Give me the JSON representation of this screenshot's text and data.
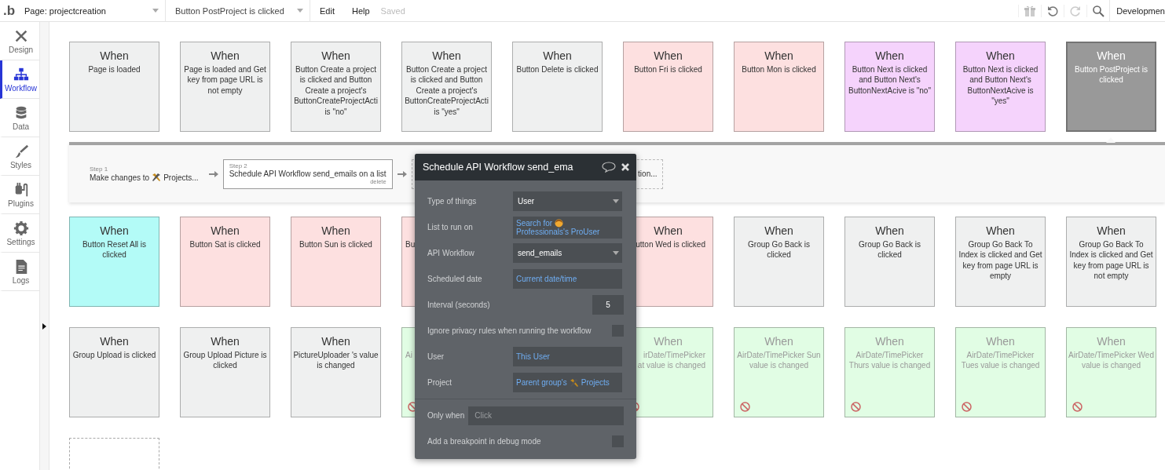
{
  "top_bar": {
    "logo": ".b",
    "page_select": "Page: projectcreation",
    "event_select": "Button PostProject is clicked",
    "menu": [
      "Edit",
      "Help"
    ],
    "save_status": "Saved",
    "environment": "Developmen"
  },
  "sidebar": {
    "items": [
      {
        "label": "Design",
        "selected": false
      },
      {
        "label": "Workflow",
        "selected": true
      },
      {
        "label": "Data",
        "selected": false
      },
      {
        "label": "Styles",
        "selected": false
      },
      {
        "label": "Plugins",
        "selected": false
      },
      {
        "label": "Settings",
        "selected": false
      },
      {
        "label": "Logs",
        "selected": false
      }
    ]
  },
  "event_rows": [
    [
      {
        "kind": "full",
        "heading": "When",
        "text": "Page is loaded",
        "color": "#eff0f0",
        "selected": false,
        "disabled": false
      },
      {
        "kind": "full",
        "heading": "When",
        "text": "Page is loaded and Get key from page URL is not empty",
        "color": "#eff0f0",
        "selected": false,
        "disabled": false
      },
      {
        "kind": "full",
        "heading": "When",
        "text": "Button Create a project is clicked and Button Create a project's ButtonCreateProjectActi is \"no\"",
        "color": "#eff0f0",
        "selected": false,
        "disabled": false
      },
      {
        "kind": "full",
        "heading": "When",
        "text": "Button Create a project is clicked and Button Create a project's ButtonCreateProjectActi is \"yes\"",
        "color": "#eff0f0",
        "selected": false,
        "disabled": false
      },
      {
        "kind": "full",
        "heading": "When",
        "text": "Button Delete is clicked",
        "color": "#eff0f0",
        "selected": false,
        "disabled": false
      },
      {
        "kind": "full",
        "heading": "When",
        "text": "Button Fri is clicked",
        "color": "#fde0e0",
        "selected": false,
        "disabled": false
      },
      {
        "kind": "full",
        "heading": "When",
        "text": "Button Mon is clicked",
        "color": "#fde0e0",
        "selected": false,
        "disabled": false
      },
      {
        "kind": "full",
        "heading": "When",
        "text": "Button Next is clicked and Button Next's ButtonNextAcive is \"no\"",
        "color": "#f5d3fc",
        "selected": false,
        "disabled": false
      },
      {
        "kind": "full",
        "heading": "When",
        "text": "Button Next is clicked and Button Next's ButtonNextAcive is \"yes\"",
        "color": "#f5d3fc",
        "selected": false,
        "disabled": false
      },
      {
        "kind": "full",
        "heading": "When",
        "text": "Button PostProject is clicked",
        "color": "#999999",
        "selected": true,
        "disabled": false
      }
    ],
    [
      {
        "kind": "full",
        "heading": "When",
        "text": "Button Reset All is clicked",
        "color": "#b3fbf7",
        "selected": false,
        "disabled": false
      },
      {
        "kind": "full",
        "heading": "When",
        "text": "Button Sat is clicked",
        "color": "#fde0e0",
        "selected": false,
        "disabled": false
      },
      {
        "kind": "full",
        "heading": "When",
        "text": "Button Sun is clicked",
        "color": "#fde0e0",
        "selected": false,
        "disabled": false
      },
      {
        "kind": "clip_left",
        "text": "Bu",
        "color": "#fde0e0",
        "selected": false,
        "disabled": false
      },
      {
        "kind": "hidden"
      },
      {
        "kind": "clip_right",
        "heading": "When",
        "text": "utton Wed is clicked",
        "color": "#fde0e0",
        "selected": false,
        "disabled": false
      },
      {
        "kind": "full",
        "heading": "When",
        "text": "Group Go Back is clicked",
        "color": "#eff0f0",
        "selected": false,
        "disabled": false
      },
      {
        "kind": "full",
        "heading": "When",
        "text": "Group Go Back is clicked",
        "color": "#eff0f0",
        "selected": false,
        "disabled": false
      },
      {
        "kind": "full",
        "heading": "When",
        "text": "Group Go Back To Index is clicked and Get key from page URL is empty",
        "color": "#eff0f0",
        "selected": false,
        "disabled": false
      },
      {
        "kind": "full",
        "heading": "When",
        "text": "Group Go Back To Index is clicked and Get key from page URL is not empty",
        "color": "#eff0f0",
        "selected": false,
        "disabled": false
      }
    ],
    [
      {
        "kind": "full",
        "heading": "When",
        "text": "Group Upload is clicked",
        "color": "#eff0f0",
        "selected": false,
        "disabled": false
      },
      {
        "kind": "full",
        "heading": "When",
        "text": "Group Upload Picture is clicked",
        "color": "#eff0f0",
        "selected": false,
        "disabled": false
      },
      {
        "kind": "full",
        "heading": "When",
        "text": "PictureUploader 's value is changed",
        "color": "#eff0f0",
        "selected": false,
        "disabled": false
      },
      {
        "kind": "clip_left",
        "text": "Ai",
        "color": "#e1fde4",
        "selected": false,
        "disabled": true
      },
      {
        "kind": "hidden"
      },
      {
        "kind": "clip_right",
        "heading": "When",
        "text": "irDate/TimePicker\nat value is changed",
        "color": "#e1fde4",
        "selected": false,
        "disabled": true
      },
      {
        "kind": "full",
        "heading": "When",
        "text": "AirDate/TimePicker Sun value is changed",
        "color": "#e1fde4",
        "selected": false,
        "disabled": true
      },
      {
        "kind": "full",
        "heading": "When",
        "text": "AirDate/TimePicker Thurs value is changed",
        "color": "#e1fde4",
        "selected": false,
        "disabled": true
      },
      {
        "kind": "full",
        "heading": "When",
        "text": "AirDate/TimePicker Tues value is changed",
        "color": "#e1fde4",
        "selected": false,
        "disabled": true
      },
      {
        "kind": "full",
        "heading": "When",
        "text": "AirDate/TimePicker Wed value is changed",
        "color": "#e1fde4",
        "selected": false,
        "disabled": true
      }
    ],
    [
      {
        "kind": "empty"
      }
    ]
  ],
  "steps": [
    {
      "kind": "make_changes",
      "step": "Step 1",
      "parts": [
        "Make changes to",
        "Projects..."
      ],
      "selected": false
    },
    {
      "kind": "action",
      "step": "Step 2",
      "parts": [
        "Schedule API Workflow send_emails on a list"
      ],
      "delete": "delete",
      "selected": true
    },
    {
      "kind": "add",
      "parts": [
        "tion..."
      ]
    }
  ],
  "popup": {
    "title": "Schedule API Workflow send_ema",
    "fields": [
      {
        "kind": "select",
        "label": "Type of things",
        "value": "User"
      },
      {
        "kind": "list_search",
        "label": "List to run on",
        "parts": [
          "Search for",
          "Professionals's ProUser"
        ]
      },
      {
        "kind": "select",
        "label": "API Workflow",
        "value": "send_emails"
      },
      {
        "kind": "expression",
        "label": "Scheduled date",
        "value": "Current date/time"
      },
      {
        "kind": "number",
        "label": "Interval (seconds)",
        "value": "5"
      },
      {
        "kind": "checkbox",
        "label": "Ignore privacy rules when running the workflow",
        "checked": false
      },
      {
        "kind": "expression",
        "label": "User",
        "value": "This User"
      },
      {
        "kind": "thing_ref",
        "label": "Project",
        "parts": [
          "Parent group's",
          "Projects"
        ]
      },
      {
        "kind": "condition",
        "label": "Only when",
        "placeholder": "Click"
      },
      {
        "kind": "checkbox",
        "label": "Add a breakpoint in debug mode",
        "checked": false
      }
    ]
  }
}
